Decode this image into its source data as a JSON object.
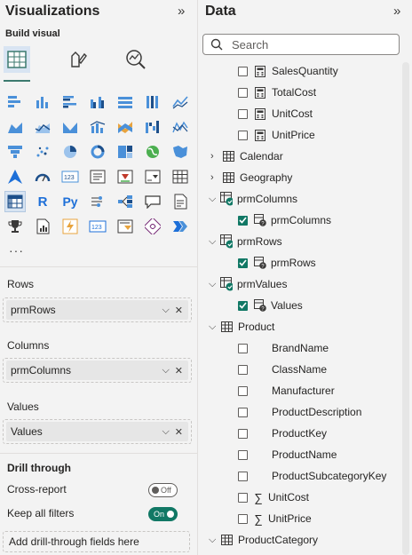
{
  "visualizations": {
    "title": "Visualizations",
    "build_visual_label": "Build visual",
    "more_label": "···",
    "wells": {
      "rows": {
        "label": "Rows",
        "field": "prmRows"
      },
      "columns": {
        "label": "Columns",
        "field": "prmColumns"
      },
      "values": {
        "label": "Values",
        "field": "Values"
      }
    },
    "drill_through": {
      "title": "Drill through",
      "cross_report": {
        "label": "Cross-report",
        "state": "Off"
      },
      "keep_all_filters": {
        "label": "Keep all filters",
        "state": "On"
      },
      "add_fields_label": "Add drill-through fields here"
    }
  },
  "data": {
    "title": "Data",
    "search_placeholder": "Search",
    "measures_top": [
      "SalesQuantity",
      "TotalCost",
      "UnitCost",
      "UnitPrice"
    ],
    "tables": {
      "calendar": "Calendar",
      "geography": "Geography",
      "prm_columns": "prmColumns",
      "prm_columns_field": "prmColumns",
      "prm_rows": "prmRows",
      "prm_rows_field": "prmRows",
      "prm_values": "prmValues",
      "prm_values_field": "Values",
      "product": "Product",
      "product_category": "ProductCategory"
    },
    "product_fields": [
      "BrandName",
      "ClassName",
      "Manufacturer",
      "ProductDescription",
      "ProductKey",
      "ProductName",
      "ProductSubcategoryKey"
    ],
    "product_measures": [
      "UnitCost",
      "UnitPrice"
    ],
    "sigma_symbol": "∑"
  },
  "colors": {
    "accent": "#117865",
    "selected": "#d8e4f2"
  }
}
